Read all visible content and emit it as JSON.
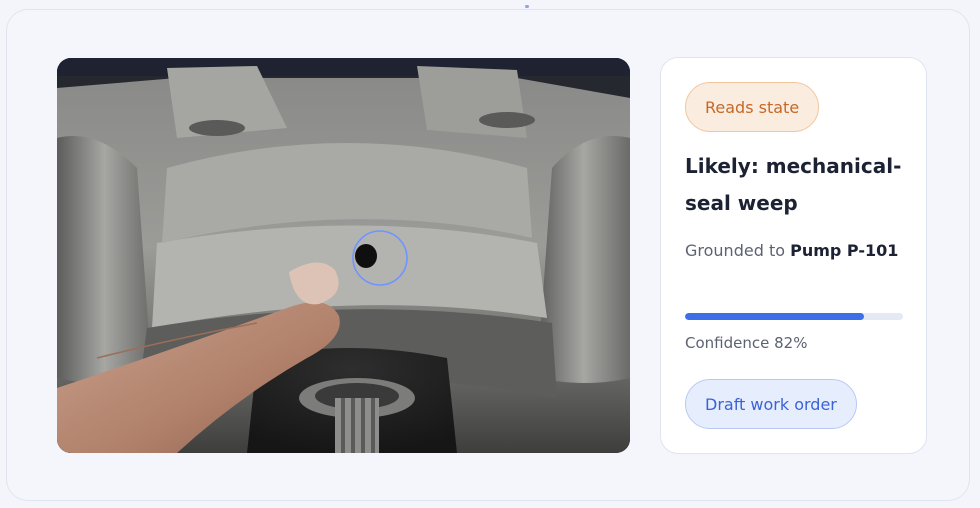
{
  "badge": {
    "label": "Reads state"
  },
  "diagnosis": {
    "title": "Likely: mechanical-seal weep"
  },
  "grounding": {
    "prefix": "Grounded to ",
    "asset": "Pump P-101"
  },
  "confidence": {
    "value": 0.82,
    "label": "Confidence 82%"
  },
  "actions": {
    "draft_work_order": "Draft work order"
  },
  "colors": {
    "accent": "#3f6fe8",
    "badge_text": "#c4692a",
    "badge_bg": "#fbece0",
    "button_text": "#3a63d8"
  }
}
